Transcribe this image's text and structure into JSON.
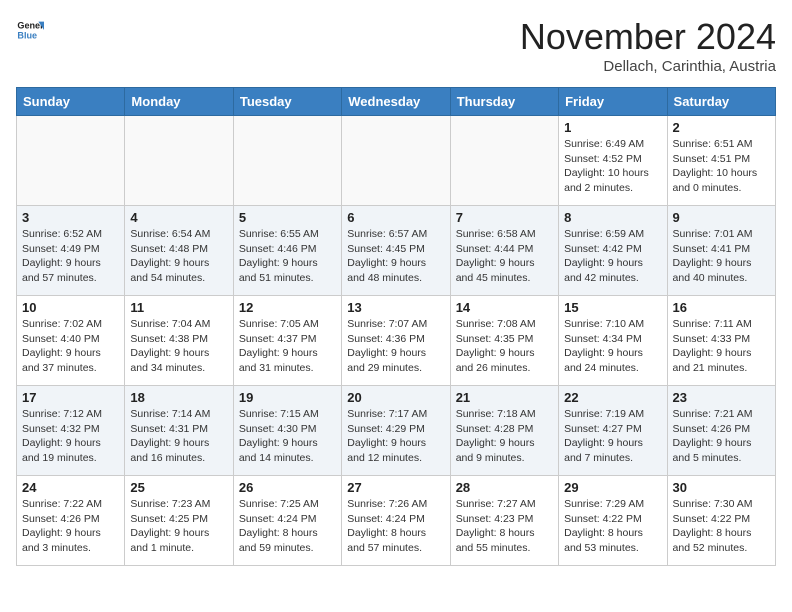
{
  "header": {
    "logo_line1": "General",
    "logo_line2": "Blue",
    "month_title": "November 2024",
    "location": "Dellach, Carinthia, Austria"
  },
  "weekdays": [
    "Sunday",
    "Monday",
    "Tuesday",
    "Wednesday",
    "Thursday",
    "Friday",
    "Saturday"
  ],
  "weeks": [
    [
      {
        "day": "",
        "info": ""
      },
      {
        "day": "",
        "info": ""
      },
      {
        "day": "",
        "info": ""
      },
      {
        "day": "",
        "info": ""
      },
      {
        "day": "",
        "info": ""
      },
      {
        "day": "1",
        "info": "Sunrise: 6:49 AM\nSunset: 4:52 PM\nDaylight: 10 hours\nand 2 minutes."
      },
      {
        "day": "2",
        "info": "Sunrise: 6:51 AM\nSunset: 4:51 PM\nDaylight: 10 hours\nand 0 minutes."
      }
    ],
    [
      {
        "day": "3",
        "info": "Sunrise: 6:52 AM\nSunset: 4:49 PM\nDaylight: 9 hours\nand 57 minutes."
      },
      {
        "day": "4",
        "info": "Sunrise: 6:54 AM\nSunset: 4:48 PM\nDaylight: 9 hours\nand 54 minutes."
      },
      {
        "day": "5",
        "info": "Sunrise: 6:55 AM\nSunset: 4:46 PM\nDaylight: 9 hours\nand 51 minutes."
      },
      {
        "day": "6",
        "info": "Sunrise: 6:57 AM\nSunset: 4:45 PM\nDaylight: 9 hours\nand 48 minutes."
      },
      {
        "day": "7",
        "info": "Sunrise: 6:58 AM\nSunset: 4:44 PM\nDaylight: 9 hours\nand 45 minutes."
      },
      {
        "day": "8",
        "info": "Sunrise: 6:59 AM\nSunset: 4:42 PM\nDaylight: 9 hours\nand 42 minutes."
      },
      {
        "day": "9",
        "info": "Sunrise: 7:01 AM\nSunset: 4:41 PM\nDaylight: 9 hours\nand 40 minutes."
      }
    ],
    [
      {
        "day": "10",
        "info": "Sunrise: 7:02 AM\nSunset: 4:40 PM\nDaylight: 9 hours\nand 37 minutes."
      },
      {
        "day": "11",
        "info": "Sunrise: 7:04 AM\nSunset: 4:38 PM\nDaylight: 9 hours\nand 34 minutes."
      },
      {
        "day": "12",
        "info": "Sunrise: 7:05 AM\nSunset: 4:37 PM\nDaylight: 9 hours\nand 31 minutes."
      },
      {
        "day": "13",
        "info": "Sunrise: 7:07 AM\nSunset: 4:36 PM\nDaylight: 9 hours\nand 29 minutes."
      },
      {
        "day": "14",
        "info": "Sunrise: 7:08 AM\nSunset: 4:35 PM\nDaylight: 9 hours\nand 26 minutes."
      },
      {
        "day": "15",
        "info": "Sunrise: 7:10 AM\nSunset: 4:34 PM\nDaylight: 9 hours\nand 24 minutes."
      },
      {
        "day": "16",
        "info": "Sunrise: 7:11 AM\nSunset: 4:33 PM\nDaylight: 9 hours\nand 21 minutes."
      }
    ],
    [
      {
        "day": "17",
        "info": "Sunrise: 7:12 AM\nSunset: 4:32 PM\nDaylight: 9 hours\nand 19 minutes."
      },
      {
        "day": "18",
        "info": "Sunrise: 7:14 AM\nSunset: 4:31 PM\nDaylight: 9 hours\nand 16 minutes."
      },
      {
        "day": "19",
        "info": "Sunrise: 7:15 AM\nSunset: 4:30 PM\nDaylight: 9 hours\nand 14 minutes."
      },
      {
        "day": "20",
        "info": "Sunrise: 7:17 AM\nSunset: 4:29 PM\nDaylight: 9 hours\nand 12 minutes."
      },
      {
        "day": "21",
        "info": "Sunrise: 7:18 AM\nSunset: 4:28 PM\nDaylight: 9 hours\nand 9 minutes."
      },
      {
        "day": "22",
        "info": "Sunrise: 7:19 AM\nSunset: 4:27 PM\nDaylight: 9 hours\nand 7 minutes."
      },
      {
        "day": "23",
        "info": "Sunrise: 7:21 AM\nSunset: 4:26 PM\nDaylight: 9 hours\nand 5 minutes."
      }
    ],
    [
      {
        "day": "24",
        "info": "Sunrise: 7:22 AM\nSunset: 4:26 PM\nDaylight: 9 hours\nand 3 minutes."
      },
      {
        "day": "25",
        "info": "Sunrise: 7:23 AM\nSunset: 4:25 PM\nDaylight: 9 hours\nand 1 minute."
      },
      {
        "day": "26",
        "info": "Sunrise: 7:25 AM\nSunset: 4:24 PM\nDaylight: 8 hours\nand 59 minutes."
      },
      {
        "day": "27",
        "info": "Sunrise: 7:26 AM\nSunset: 4:24 PM\nDaylight: 8 hours\nand 57 minutes."
      },
      {
        "day": "28",
        "info": "Sunrise: 7:27 AM\nSunset: 4:23 PM\nDaylight: 8 hours\nand 55 minutes."
      },
      {
        "day": "29",
        "info": "Sunrise: 7:29 AM\nSunset: 4:22 PM\nDaylight: 8 hours\nand 53 minutes."
      },
      {
        "day": "30",
        "info": "Sunrise: 7:30 AM\nSunset: 4:22 PM\nDaylight: 8 hours\nand 52 minutes."
      }
    ]
  ]
}
